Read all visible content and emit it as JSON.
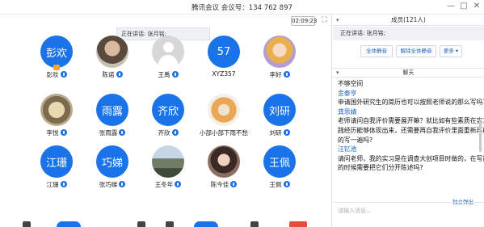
{
  "window": {
    "title": "腾讯会议 会议号：134 762 897",
    "controls": [
      "—",
      "□",
      "✕"
    ]
  },
  "stage": {
    "timer": "02:09:23",
    "speaking_tip": "正在讲话: 张月铭;",
    "participants": [
      {
        "name": "彭欢",
        "avatar_text": "彭欢",
        "avatar": "blue",
        "mic": false,
        "host": true
      },
      {
        "name": "陈诺",
        "avatar_text": "",
        "avatar": "photo",
        "mic": true
      },
      {
        "name": "王禹",
        "avatar_text": "",
        "avatar": "default-gray",
        "mic": true
      },
      {
        "name": "XYZ357",
        "avatar_text": "57",
        "avatar": "blue",
        "mic": false
      },
      {
        "name": "李好",
        "avatar_text": "",
        "avatar": "photo",
        "mic": true
      },
      {
        "name": "李悦",
        "avatar_text": "",
        "avatar": "photo",
        "mic": true
      },
      {
        "name": "张雨露",
        "avatar_text": "雨露",
        "avatar": "blue",
        "mic": true
      },
      {
        "name": "齐欣",
        "avatar_text": "齐欣",
        "avatar": "blue",
        "mic": true
      },
      {
        "name": "小部小部下雨不愁",
        "avatar_text": "",
        "avatar": "photo",
        "mic": false
      },
      {
        "name": "刘研",
        "avatar_text": "刘研",
        "avatar": "blue",
        "mic": true
      },
      {
        "name": "江珊",
        "avatar_text": "江珊",
        "avatar": "blue",
        "mic": true
      },
      {
        "name": "张巧娣",
        "avatar_text": "巧娣",
        "avatar": "blue",
        "mic": true
      },
      {
        "name": "王冬年",
        "avatar_text": "",
        "avatar": "photo",
        "mic": true
      },
      {
        "name": "陈今佳",
        "avatar_text": "",
        "avatar": "photo",
        "mic": true
      },
      {
        "name": "王佩",
        "avatar_text": "王佩",
        "avatar": "blue",
        "mic": true
      }
    ]
  },
  "panel": {
    "members_title": "成员(121人)",
    "speaking": "正在讲话: 张月铭;",
    "buttons": {
      "mute_all": "全体静音",
      "unmute_all": "解除全体静音",
      "more": "更多 ▾"
    },
    "chat_title": "聊天",
    "chat_lines": [
      {
        "text": "不够空间",
        "sender": false
      },
      {
        "text": "金泰亨",
        "sender": true
      },
      {
        "text": "申请国外研究生的简历也可以按照老师说的那么写吗?",
        "sender": false
      },
      {
        "text": "龚思婧",
        "sender": true
      },
      {
        "text": "老师请问自我评价需要展开嘛？就比如有些素质在实习实",
        "sender": false
      },
      {
        "text": "践经历能够体现出来，还需要再自我评价里面重新再概括",
        "sender": false
      },
      {
        "text": "的写一遍吗?",
        "sender": false
      },
      {
        "text": "汪钇池",
        "sender": true
      },
      {
        "text": "请问老师，我的实习是在调查大创项目时做的，在写简历",
        "sender": false
      },
      {
        "text": "的时候需要把它们分开陈述吗?",
        "sender": false
      }
    ],
    "popout": "独立弹出",
    "input_placeholder": "请输入消息..."
  },
  "colors": {
    "accent": "#1a73e8",
    "link": "#1a5fc0"
  }
}
